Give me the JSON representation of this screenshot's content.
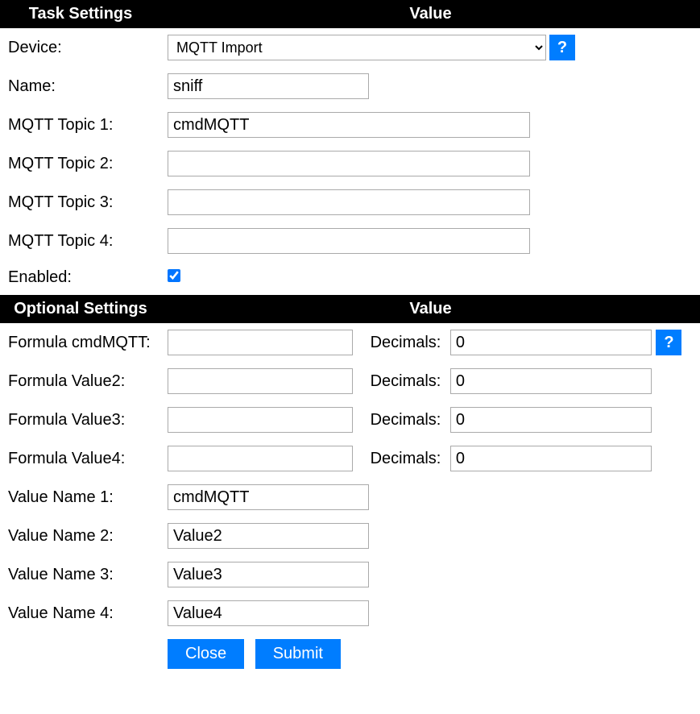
{
  "headers": {
    "task_settings": "Task Settings",
    "value1": "Value",
    "optional_settings": "Optional Settings",
    "value2": "Value"
  },
  "labels": {
    "device": "Device:",
    "name": "Name:",
    "mqtt_topic_1": "MQTT Topic 1:",
    "mqtt_topic_2": "MQTT Topic 2:",
    "mqtt_topic_3": "MQTT Topic 3:",
    "mqtt_topic_4": "MQTT Topic 4:",
    "enabled": "Enabled:",
    "formula_cmdmqtt": "Formula cmdMQTT:",
    "formula_value2": "Formula Value2:",
    "formula_value3": "Formula Value3:",
    "formula_value4": "Formula Value4:",
    "decimals": "Decimals:",
    "value_name_1": "Value Name 1:",
    "value_name_2": "Value Name 2:",
    "value_name_3": "Value Name 3:",
    "value_name_4": "Value Name 4:"
  },
  "fields": {
    "device_selected": "MQTT Import",
    "name": "sniff",
    "mqtt_topic_1": "cmdMQTT",
    "mqtt_topic_2": "",
    "mqtt_topic_3": "",
    "mqtt_topic_4": "",
    "enabled": true,
    "formula_cmdmqtt": "",
    "formula_value2": "",
    "formula_value3": "",
    "formula_value4": "",
    "decimals_cmdmqtt": "0",
    "decimals_value2": "0",
    "decimals_value3": "0",
    "decimals_value4": "0",
    "value_name_1": "cmdMQTT",
    "value_name_2": "Value2",
    "value_name_3": "Value3",
    "value_name_4": "Value4"
  },
  "buttons": {
    "help": "?",
    "close": "Close",
    "submit": "Submit"
  }
}
